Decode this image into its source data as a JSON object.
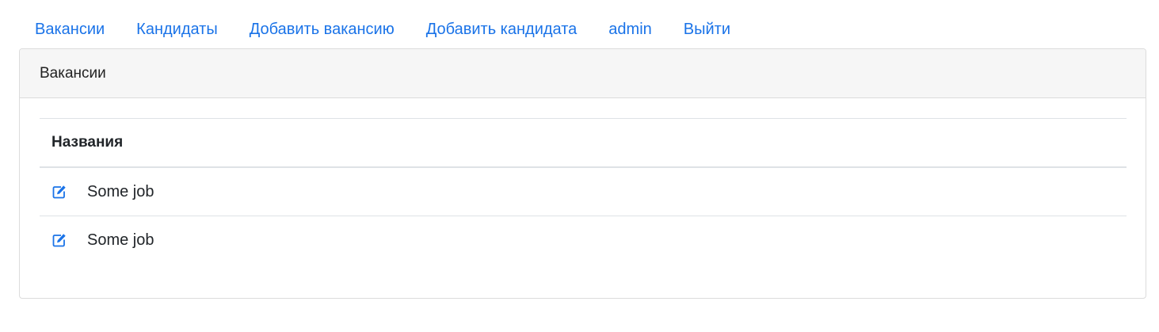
{
  "nav": {
    "items": [
      {
        "label": "Вакансии"
      },
      {
        "label": "Кандидаты"
      },
      {
        "label": "Добавить вакансию"
      },
      {
        "label": "Добавить кандидата"
      },
      {
        "label": "admin"
      },
      {
        "label": "Выйти"
      }
    ]
  },
  "card": {
    "header_title": "Вакансии",
    "table": {
      "columns": [
        "Названия"
      ],
      "rows": [
        {
          "icon": "edit-icon",
          "name": "Some job"
        },
        {
          "icon": "edit-icon",
          "name": "Some job"
        }
      ]
    }
  },
  "colors": {
    "link": "#1a73e8",
    "header_bg": "#f6f6f6",
    "border": "#dcdcdc"
  }
}
